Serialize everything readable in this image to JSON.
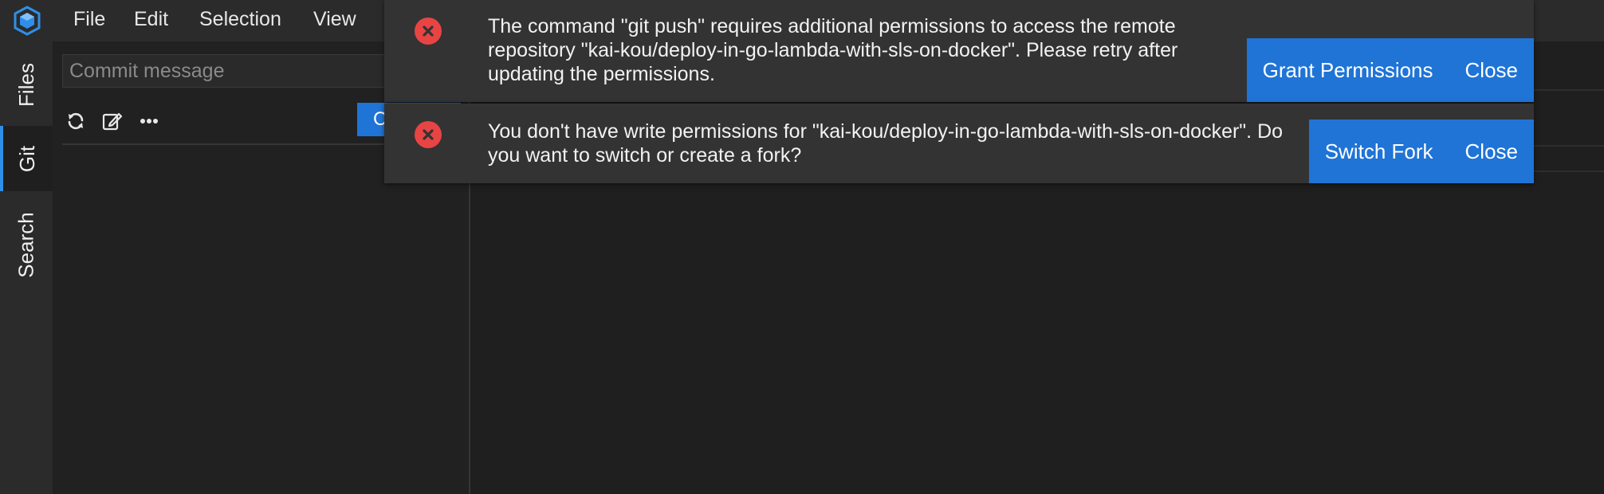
{
  "menu": {
    "items": [
      "File",
      "Edit",
      "Selection",
      "View"
    ]
  },
  "activity_bar": {
    "logo_icon": "cube-logo-icon",
    "tabs": [
      {
        "label": "Files"
      },
      {
        "label": "Git",
        "active": true
      },
      {
        "label": "Search"
      }
    ]
  },
  "git_panel": {
    "commit_placeholder": "Commit message",
    "commit_value": "",
    "commit_button_label": "C",
    "toolbar_icons": [
      "refresh-icon",
      "edit-icon",
      "more-icon"
    ]
  },
  "notifications": [
    {
      "type": "error",
      "icon": "error-x-icon",
      "message": "The command \"git push\" requires additional permissions to access the remote repository \"kai-kou/deploy-in-go-lambda-with-sls-on-docker\". Please retry after updating the permissions.",
      "actions": [
        "Grant Permissions",
        "Close"
      ]
    },
    {
      "type": "error",
      "icon": "error-x-icon",
      "message": "You don't have write permissions for \"kai-kou/deploy-in-go-lambda-with-sls-on-docker\". Do you want to switch or create a fork?",
      "actions": [
        "Switch Fork",
        "Close"
      ]
    }
  ],
  "colors": {
    "accent": "#1f74d6",
    "error": "#e84444",
    "background": "#1f1f1f",
    "sidebar": "#2b2b2b",
    "notification_bg": "#333333"
  }
}
